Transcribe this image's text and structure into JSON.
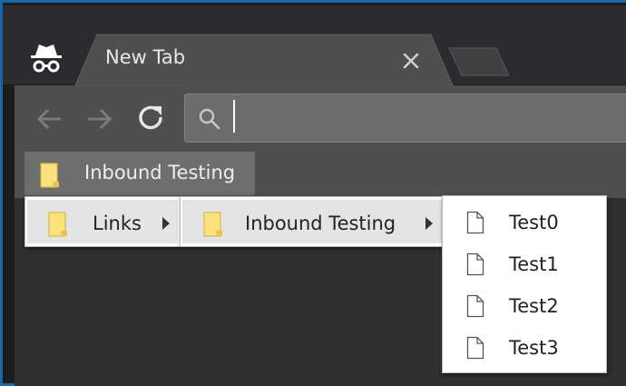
{
  "browser": {
    "tab": {
      "title": "New Tab"
    },
    "omnibox": {
      "value": "",
      "placeholder": ""
    }
  },
  "bookmarks_bar": {
    "items": [
      {
        "label": "Inbound Testing"
      }
    ]
  },
  "menus": {
    "level1": [
      {
        "label": "Links"
      }
    ],
    "level2": [
      {
        "label": "Inbound Testing"
      }
    ],
    "level3": [
      {
        "label": "Test0"
      },
      {
        "label": "Test1"
      },
      {
        "label": "Test2"
      },
      {
        "label": "Test3"
      }
    ]
  },
  "colors": {
    "folder": "#fbe27c",
    "folder_edge": "#d9b84a",
    "window_frame": "#1767a7"
  }
}
